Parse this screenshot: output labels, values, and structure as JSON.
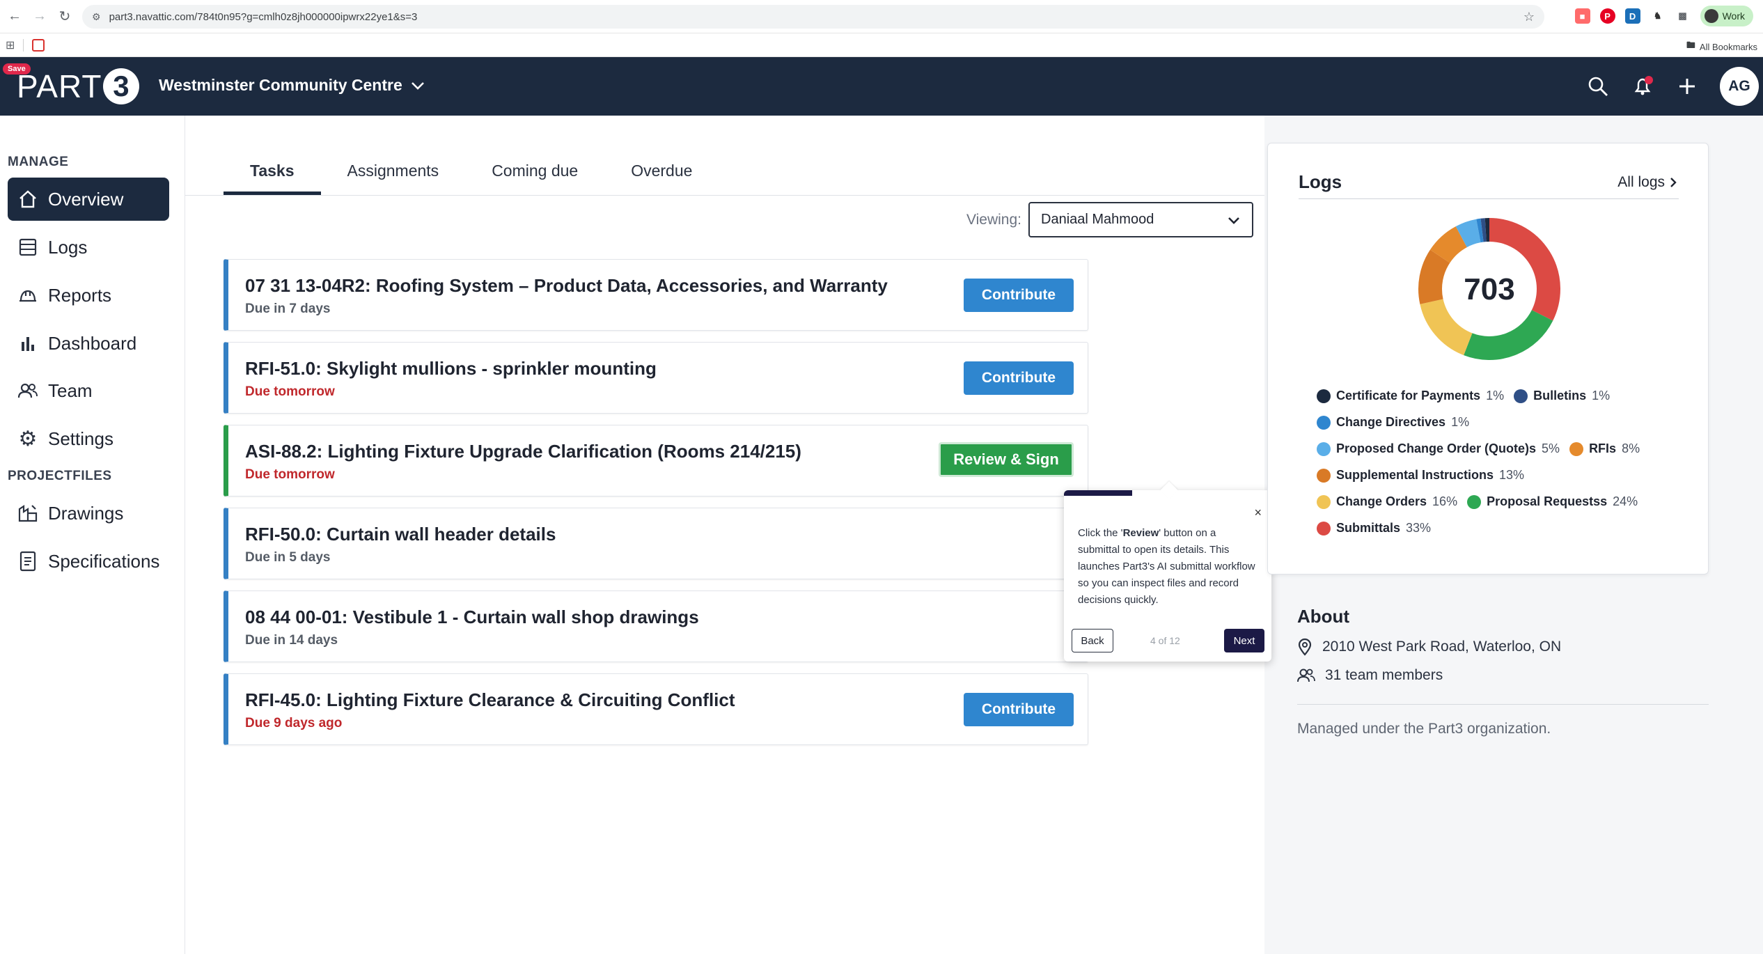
{
  "browser": {
    "url": "part3.navattic.com/784t0n95?g=cmlh0z8jh000000ipwrx22ye1&s=3",
    "profile_label": "Work",
    "all_bookmarks": "All Bookmarks"
  },
  "header": {
    "save_badge": "Save",
    "logo_text": "PART",
    "logo_digit": "3",
    "project_name": "Westminster Community Centre",
    "avatar_initials": "AG"
  },
  "sidebar": {
    "manage_label": "MANAGE",
    "projectfiles_label": "PROJECTFILES",
    "items": [
      {
        "label": "Overview",
        "icon": "home-icon"
      },
      {
        "label": "Logs",
        "icon": "list-icon"
      },
      {
        "label": "Reports",
        "icon": "hardhat-icon"
      },
      {
        "label": "Dashboard",
        "icon": "bar-chart-icon"
      },
      {
        "label": "Team",
        "icon": "team-icon"
      },
      {
        "label": "Settings",
        "icon": "gear-icon"
      }
    ],
    "files": [
      {
        "label": "Drawings",
        "icon": "drawing-icon"
      },
      {
        "label": "Specifications",
        "icon": "document-icon"
      }
    ]
  },
  "main": {
    "tabs": [
      "Tasks",
      "Assignments",
      "Coming due",
      "Overdue"
    ],
    "viewing_label": "Viewing:",
    "viewing_value": "Daniaal Mahmood",
    "tasks": [
      {
        "title": "07 31 13-04R2: Roofing System – Product Data, Accessories, and Warranty",
        "due": "Due in 7 days",
        "action": "Contribute"
      },
      {
        "title": "RFI-51.0: Skylight mullions - sprinkler mounting",
        "due": "Due tomorrow",
        "action": "Contribute"
      },
      {
        "title": "ASI-88.2: Lighting Fixture Upgrade Clarification (Rooms 214/215)",
        "due": "Due tomorrow",
        "action": "Review & Sign"
      },
      {
        "title": "RFI-50.0: Curtain wall header details",
        "due": "Due in 5 days",
        "action": ""
      },
      {
        "title": "08 44 00-01: Vestibule 1 - Curtain wall shop drawings",
        "due": "Due in 14 days",
        "action": ""
      },
      {
        "title": "RFI-45.0: Lighting Fixture Clearance & Circuiting Conflict",
        "due": "Due 9 days ago",
        "action": "Contribute"
      }
    ]
  },
  "tooltip": {
    "text_before": "Click the '",
    "text_bold": "Review",
    "text_after": "' button on a submittal to open its details. This launches Part3's AI submittal workflow so you can inspect files and record decisions quickly.",
    "back": "Back",
    "step": "4 of 12",
    "next": "Next",
    "close": "×"
  },
  "logs": {
    "title": "Logs",
    "all_logs": "All logs",
    "total": "703"
  },
  "about": {
    "title": "About",
    "address": "2010 West Park Road, Waterloo, ON",
    "members": "31 team members",
    "note": "Managed under the Part3 organization."
  },
  "chart_data": {
    "type": "pie",
    "center_label": "703",
    "categories": [
      "Certificate for Payments",
      "Bulletins",
      "Change Directives",
      "Proposed Change Order (Quote)s",
      "RFIs",
      "Supplemental Instructions",
      "Change Orders",
      "Proposal Requestss",
      "Submittals"
    ],
    "values": [
      1,
      1,
      1,
      5,
      8,
      13,
      16,
      24,
      33
    ],
    "labels": [
      "1%",
      "1%",
      "1%",
      "5%",
      "8%",
      "13%",
      "16%",
      "24%",
      "33%"
    ],
    "colors": [
      "#1c2a3f",
      "#2f4f86",
      "#2f86cf",
      "#5aaee8",
      "#e58a2c",
      "#d97a26",
      "#f0c455",
      "#2ea853",
      "#dc4a44"
    ],
    "legend_rows": [
      [
        0,
        1
      ],
      [
        2
      ],
      [
        3,
        4
      ],
      [
        5
      ],
      [
        6,
        7
      ],
      [
        8
      ]
    ]
  }
}
